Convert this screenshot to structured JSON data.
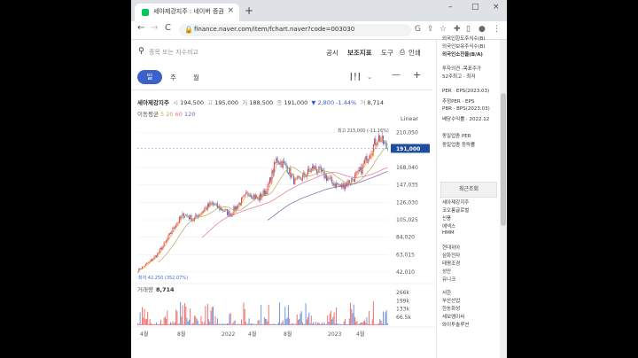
{
  "browser": {
    "tab_title": "세아제강지주 : 네이버 증권",
    "tab_close": "×",
    "new_tab": "+",
    "url": "finance.naver.com/item/fchart.naver?code=003030",
    "nav_back": "←",
    "nav_forward": "→",
    "nav_reload": "C",
    "win_min": "–",
    "win_max": "□",
    "win_close": "×"
  },
  "search": {
    "placeholder": "종목 또는 지수비교",
    "tools": [
      "공시",
      "보조지표",
      "도구",
      "인쇄"
    ]
  },
  "periods": {
    "active": "일",
    "items": [
      "주",
      "월"
    ]
  },
  "stock": {
    "name": "세아제강지주",
    "open_label": "시",
    "open": "194,500",
    "high_label": "고",
    "high": "195,000",
    "low_label": "저",
    "low": "188,500",
    "close_label": "종",
    "close": "191,000",
    "change": "▼ 2,800",
    "change_pct": "-1.44%",
    "volume_label": "거",
    "volume": "8,714"
  },
  "ma": {
    "label": "이동평균",
    "periods": [
      "5",
      "20",
      "60",
      "120"
    ],
    "colors": [
      "#e8a33d",
      "#b7a84f",
      "#e07090",
      "#7e5aa8"
    ]
  },
  "scale_mode": "Linear",
  "chart_data": {
    "type": "candlestick",
    "price_ticks": [
      "210,050",
      "168,040",
      "147,035",
      "126,030",
      "105,025",
      "84,020",
      "63,015",
      "42,010"
    ],
    "price_tick_values": [
      210050,
      168040,
      147035,
      126030,
      105025,
      84020,
      63015,
      42010
    ],
    "current_price_label": "191,000",
    "current_price": 191000,
    "high_note": "최고 215,000 (-11.16%)",
    "high_value": 215000,
    "low_note": "최저 42,250 (352.07%)",
    "low_value": 42250,
    "volume_label": "거래량",
    "volume": "8,714",
    "volume_ticks": [
      "266k",
      "199k",
      "133k",
      "66.5k"
    ],
    "volume_tick_values": [
      266000,
      199000,
      133000,
      66500
    ],
    "x_labels": [
      "4월",
      "8월",
      "2022",
      "4월",
      "8월",
      "2023",
      "4월"
    ],
    "monthly_closes": [
      44000,
      52000,
      62000,
      78000,
      98000,
      112000,
      105000,
      116000,
      124000,
      118000,
      112000,
      125000,
      138000,
      130000,
      142000,
      178000,
      170000,
      150000,
      158000,
      168000,
      160000,
      150000,
      145000,
      152000,
      162000,
      185000,
      205000,
      191000
    ],
    "up_color": "#e8413c",
    "down_color": "#3b6fd8"
  },
  "sidebar": {
    "top_items": [
      "외국인한도주식수(B)",
      "외국인보유주식수(B)",
      "외국인소진율(B/A)"
    ],
    "mid_items": [
      "투자의견 ·목표주가",
      "52주최고 · 최저"
    ],
    "per_items": [
      "PER · EPS(2023.03)",
      "추정PER · EPS",
      "PBR · BPS(2023.03)",
      "배당수익률 · 2022.12"
    ],
    "sector_items": [
      "동일업종 PER",
      "동일업종 등락률"
    ],
    "recent_header": "최근조회",
    "recent_items": [
      "세아제강지주",
      "코오롱글로벌",
      "신풍",
      "에넥스",
      "HMM",
      "현대위아",
      "삼화전자",
      "태평조경",
      "성안",
      "유니크",
      "서한",
      "부산산업",
      "한농화성",
      "세보엠이씨",
      "와이투솔루션"
    ]
  }
}
